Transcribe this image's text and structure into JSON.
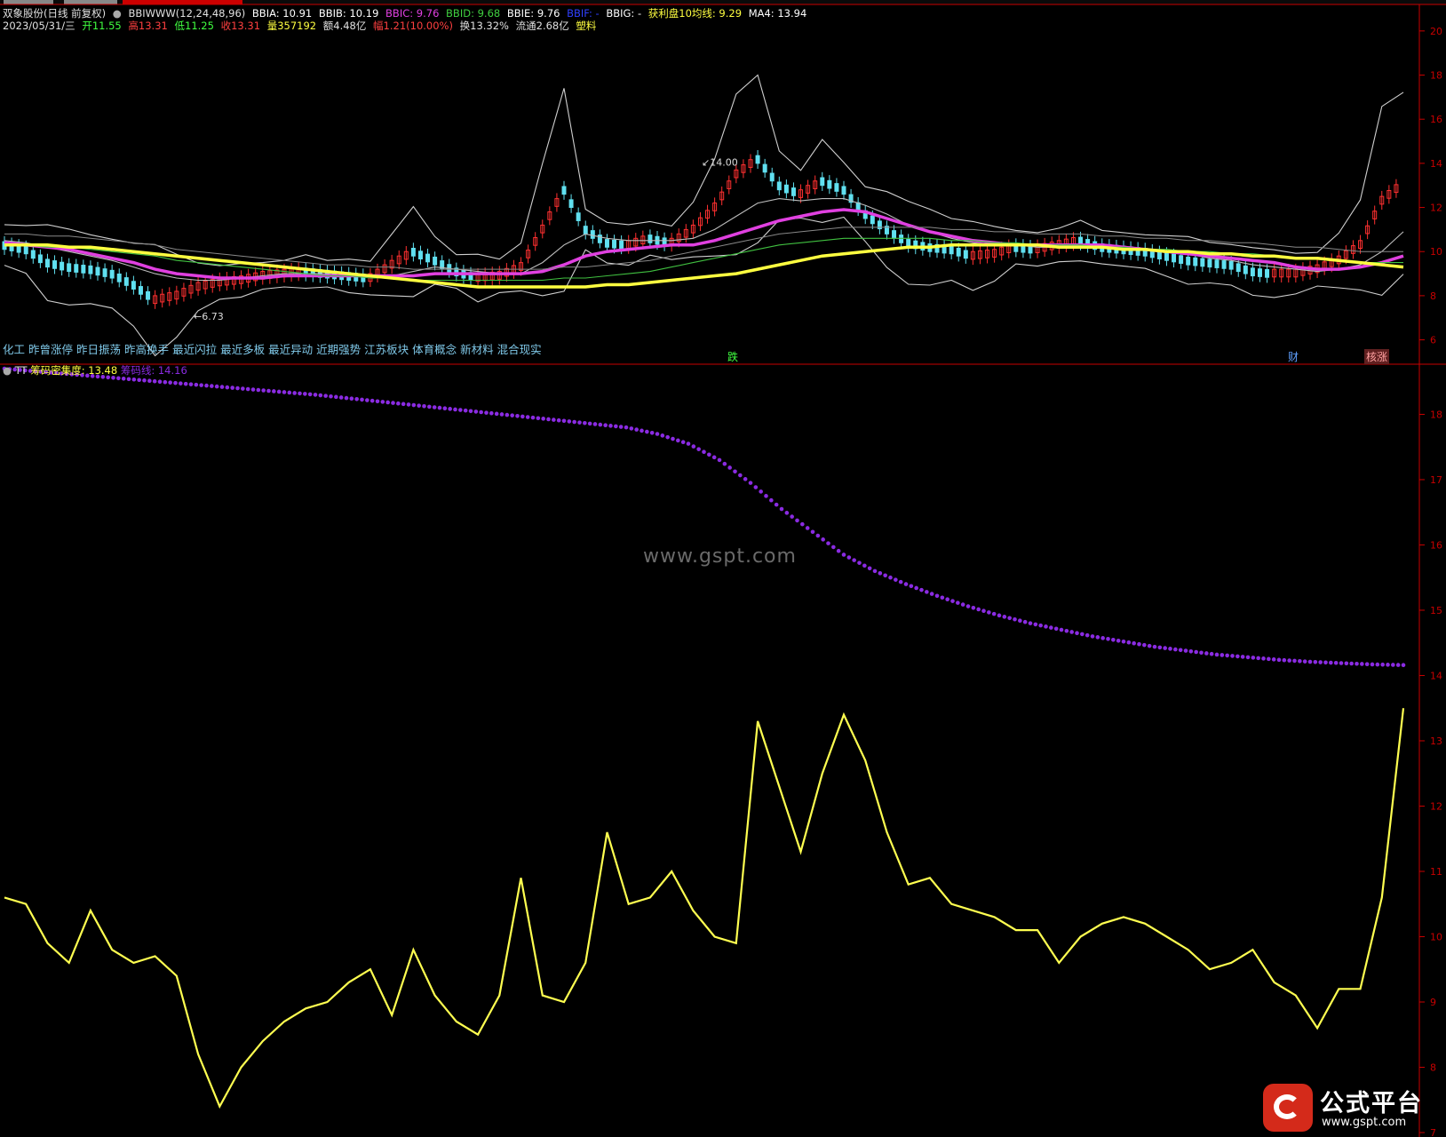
{
  "colors": {
    "bg": "#000000",
    "frame_red": "#c80000",
    "yellow_line": "#ffff40",
    "magenta_line": "#e040e0",
    "purple_dots": "#8a2be2",
    "candle_up": "#ff3030",
    "candle_down": "#60e0f0",
    "white_band": "#d8d8d8"
  },
  "header": {
    "stock": "双象股份(日线 前复权)",
    "indicator_name": "BBIWWW(12,24,48,96)",
    "bbia": "BBIA: 10.91",
    "bbib": "BBIB: 10.19",
    "bbic": "BBIC: 9.76",
    "bbid": "BBID: 9.68",
    "bbie": "BBIE: 9.76",
    "bbif": "BBIF: -",
    "bbig": "BBIG: -",
    "profit_line": "获利盘10均线: 9.29",
    "ma4": "MA4: 13.94"
  },
  "quote": {
    "date": "2023/05/31/三",
    "open": "开11.55",
    "high": "高13.31",
    "low": "低11.25",
    "close": "收13.31",
    "volume": "量357192",
    "amount": "额4.48亿",
    "change": "幅1.21(10.00%)",
    "turnover": "换13.32%",
    "float": "流通2.68亿",
    "sector": "塑料"
  },
  "concepts": [
    "化工",
    "昨曾涨停",
    "昨日振荡",
    "昨高换手",
    "最近闪拉",
    "最近多板",
    "最近异动",
    "近期强势",
    "江苏板块",
    "体育概念",
    "新材料",
    "混合现实"
  ],
  "markers": {
    "fall": "跌",
    "finance": "财",
    "limit_up": "核涨"
  },
  "annotations": {
    "high_label": "14.00",
    "low_label": "6.73"
  },
  "indicator": {
    "name": "TT",
    "density_label": "筹码密集度: 13.48",
    "chip_line_label": "筹码线: 14.16"
  },
  "price_axis_ticks": [
    "20",
    "18",
    "16",
    "14",
    "12",
    "10",
    "8",
    "6"
  ],
  "indicator_axis_ticks": [
    "18",
    "17",
    "16",
    "15",
    "14",
    "13",
    "12",
    "11",
    "10",
    "9",
    "8",
    "7"
  ],
  "watermark": "www.gspt.com",
  "logo": {
    "name": "公式平台",
    "url": "www.gspt.com"
  },
  "chart_data": [
    {
      "type": "line",
      "title": "BBIWWW(12,24,48,96)",
      "ylim": [
        5.5,
        21
      ],
      "series": [
        {
          "name": "BBIA",
          "values": [
            10.3,
            10.1,
            9.5,
            9.3,
            9.2,
            9.0,
            8.5,
            7.8,
            8.0,
            8.4,
            8.6,
            8.7,
            8.9,
            9.0,
            9.1,
            9.0,
            8.9,
            8.8,
            9.4,
            10.0,
            9.6,
            9.1,
            8.8,
            8.9,
            9.3,
            11.0,
            12.8,
            11.0,
            10.4,
            10.3,
            10.6,
            10.4,
            11.0,
            12.0,
            13.5,
            14.2,
            13.0,
            12.6,
            13.2,
            12.8,
            11.7,
            11.0,
            10.4,
            10.2,
            10.1,
            9.8,
            9.9,
            10.2,
            10.1,
            10.3,
            10.5,
            10.2,
            10.1,
            10.0,
            9.8,
            9.6,
            9.5,
            9.4,
            9.1,
            9.0,
            9.0,
            9.2,
            9.6,
            10.3,
            12.3,
            13.1
          ]
        },
        {
          "name": "BBIB",
          "values": [
            10.5,
            10.4,
            10.2,
            10.0,
            9.8,
            9.6,
            9.3,
            9.0,
            8.8,
            8.7,
            8.7,
            8.8,
            8.9,
            9.0,
            9.0,
            9.0,
            9.0,
            8.9,
            8.9,
            9.1,
            9.3,
            9.2,
            9.1,
            9.0,
            9.0,
            9.5,
            10.3,
            10.8,
            10.6,
            10.5,
            10.5,
            10.5,
            10.6,
            11.0,
            11.6,
            12.2,
            12.4,
            12.3,
            12.4,
            12.4,
            12.1,
            11.7,
            11.2,
            10.9,
            10.6,
            10.4,
            10.3,
            10.3,
            10.2,
            10.2,
            10.3,
            10.3,
            10.2,
            10.1,
            10.0,
            9.9,
            9.7,
            9.6,
            9.4,
            9.3,
            9.2,
            9.1,
            9.2,
            9.4,
            10.0,
            10.9
          ]
        },
        {
          "name": "BBIC",
          "values": [
            10.4,
            10.3,
            10.2,
            10.1,
            9.9,
            9.7,
            9.5,
            9.2,
            9.0,
            8.9,
            8.8,
            8.8,
            8.8,
            8.9,
            8.9,
            8.9,
            8.9,
            8.9,
            8.9,
            8.9,
            9.0,
            9.0,
            9.0,
            9.0,
            9.0,
            9.1,
            9.4,
            9.8,
            10.0,
            10.1,
            10.2,
            10.3,
            10.3,
            10.5,
            10.8,
            11.1,
            11.4,
            11.6,
            11.8,
            11.9,
            11.8,
            11.5,
            11.2,
            10.9,
            10.7,
            10.5,
            10.4,
            10.3,
            10.3,
            10.3,
            10.3,
            10.3,
            10.2,
            10.1,
            10.0,
            9.9,
            9.8,
            9.7,
            9.6,
            9.5,
            9.3,
            9.2,
            9.2,
            9.3,
            9.5,
            9.8
          ]
        },
        {
          "name": "BBIE",
          "values": [
            10.3,
            10.3,
            10.2,
            10.2,
            10.1,
            10.0,
            9.9,
            9.8,
            9.6,
            9.5,
            9.4,
            9.3,
            9.2,
            9.1,
            9.0,
            8.9,
            8.9,
            8.8,
            8.8,
            8.7,
            8.7,
            8.7,
            8.7,
            8.7,
            8.7,
            8.7,
            8.8,
            8.8,
            8.9,
            9.0,
            9.1,
            9.3,
            9.5,
            9.7,
            9.9,
            10.1,
            10.3,
            10.4,
            10.5,
            10.6,
            10.6,
            10.6,
            10.6,
            10.6,
            10.5,
            10.5,
            10.4,
            10.4,
            10.3,
            10.3,
            10.3,
            10.2,
            10.2,
            10.1,
            10.1,
            10.0,
            10.0,
            9.9,
            9.9,
            9.8,
            9.7,
            9.7,
            9.6,
            9.5,
            9.5,
            9.5
          ]
        },
        {
          "name": "获利盘10均线",
          "values": [
            10.3,
            10.3,
            10.3,
            10.2,
            10.2,
            10.1,
            10.0,
            9.9,
            9.8,
            9.7,
            9.6,
            9.5,
            9.4,
            9.3,
            9.2,
            9.1,
            9.0,
            8.9,
            8.8,
            8.7,
            8.6,
            8.5,
            8.4,
            8.4,
            8.4,
            8.4,
            8.4,
            8.4,
            8.5,
            8.5,
            8.6,
            8.7,
            8.8,
            8.9,
            9.0,
            9.2,
            9.4,
            9.6,
            9.8,
            9.9,
            10.0,
            10.1,
            10.2,
            10.2,
            10.3,
            10.3,
            10.3,
            10.3,
            10.3,
            10.2,
            10.2,
            10.2,
            10.1,
            10.1,
            10.0,
            10.0,
            9.9,
            9.9,
            9.8,
            9.8,
            9.7,
            9.7,
            9.6,
            9.5,
            9.4,
            9.3
          ]
        }
      ]
    },
    {
      "type": "line",
      "title": "TT",
      "ylim": [
        7,
        18.7
      ],
      "series": [
        {
          "name": "筹码密集度",
          "values": [
            10.6,
            10.5,
            9.9,
            9.6,
            10.4,
            9.8,
            9.6,
            9.7,
            9.4,
            8.2,
            7.4,
            8.0,
            8.4,
            8.7,
            8.9,
            9.0,
            9.3,
            9.5,
            8.8,
            9.8,
            9.1,
            8.7,
            8.5,
            9.1,
            10.9,
            9.1,
            9.0,
            9.6,
            11.6,
            10.5,
            10.6,
            11.0,
            10.4,
            10.0,
            9.9,
            13.3,
            12.3,
            11.3,
            12.5,
            13.4,
            12.7,
            11.6,
            10.8,
            10.9,
            10.5,
            10.4,
            10.3,
            10.1,
            10.1,
            9.6,
            10.0,
            10.2,
            10.3,
            10.2,
            10.0,
            9.8,
            9.5,
            9.6,
            9.8,
            9.3,
            9.1,
            8.6,
            9.2,
            9.2,
            10.6,
            13.5
          ]
        },
        {
          "name": "筹码线",
          "values": [
            18.7,
            18.66,
            18.62,
            18.58,
            18.54,
            18.5,
            18.46,
            18.42,
            18.38,
            18.34,
            18.3,
            18.25,
            18.2,
            18.15,
            18.1,
            18.05,
            18.0,
            17.95,
            17.9,
            17.85,
            17.8,
            17.7,
            17.55,
            17.3,
            16.95,
            16.55,
            16.2,
            15.85,
            15.6,
            15.4,
            15.22,
            15.06,
            14.92,
            14.8,
            14.7,
            14.6,
            14.52,
            14.44,
            14.38,
            14.32,
            14.28,
            14.24,
            14.21,
            14.19,
            14.17,
            14.16
          ]
        }
      ]
    }
  ]
}
